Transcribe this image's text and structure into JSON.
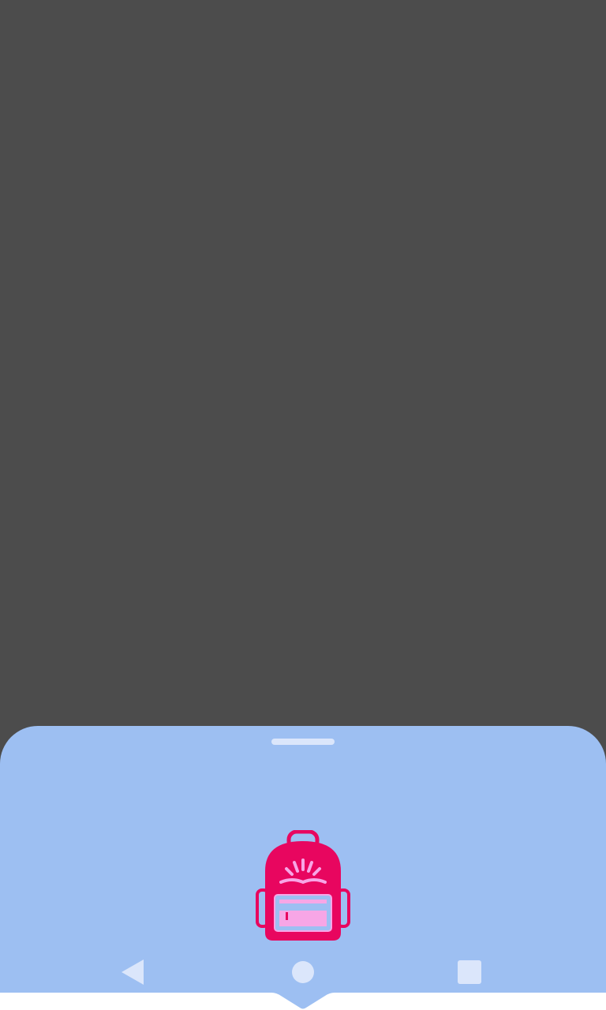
{
  "app": {
    "logo_icon": "backpack-icon",
    "colors": {
      "overlay": "#4c4c4c",
      "sheet": "#9dbff2",
      "handle": "#dbe6fb",
      "logo_primary": "#e8065f",
      "logo_accent": "#f7a6e6"
    }
  },
  "navigation": {
    "back_icon": "back-triangle-icon",
    "home_icon": "home-circle-icon",
    "recents_icon": "recents-square-icon"
  }
}
